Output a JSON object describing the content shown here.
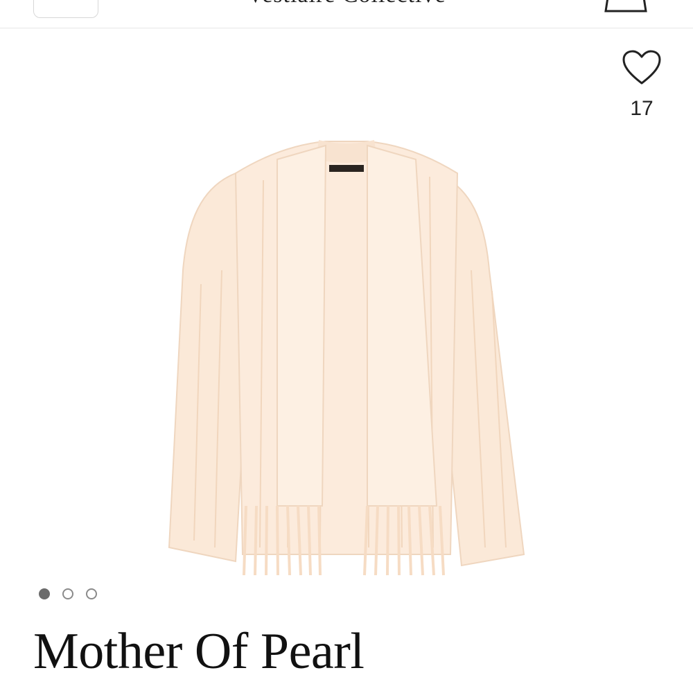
{
  "header": {
    "brand": "Vestiaire Collective",
    "search_icon": "search-icon",
    "bag_icon": "shopping-bag-icon"
  },
  "favorites": {
    "icon": "heart-icon",
    "count": "17"
  },
  "product": {
    "image_icon": "product-photo",
    "title": "Mother Of Pearl"
  },
  "carousel": {
    "total": 3,
    "active_index": 0
  },
  "colors": {
    "sweater": "#fbe9d8",
    "sweater_shadow": "#f1d6bd",
    "dot_active": "#6b6b6b",
    "dot_inactive": "#8a8a8a",
    "divider": "#e6e6e6"
  }
}
